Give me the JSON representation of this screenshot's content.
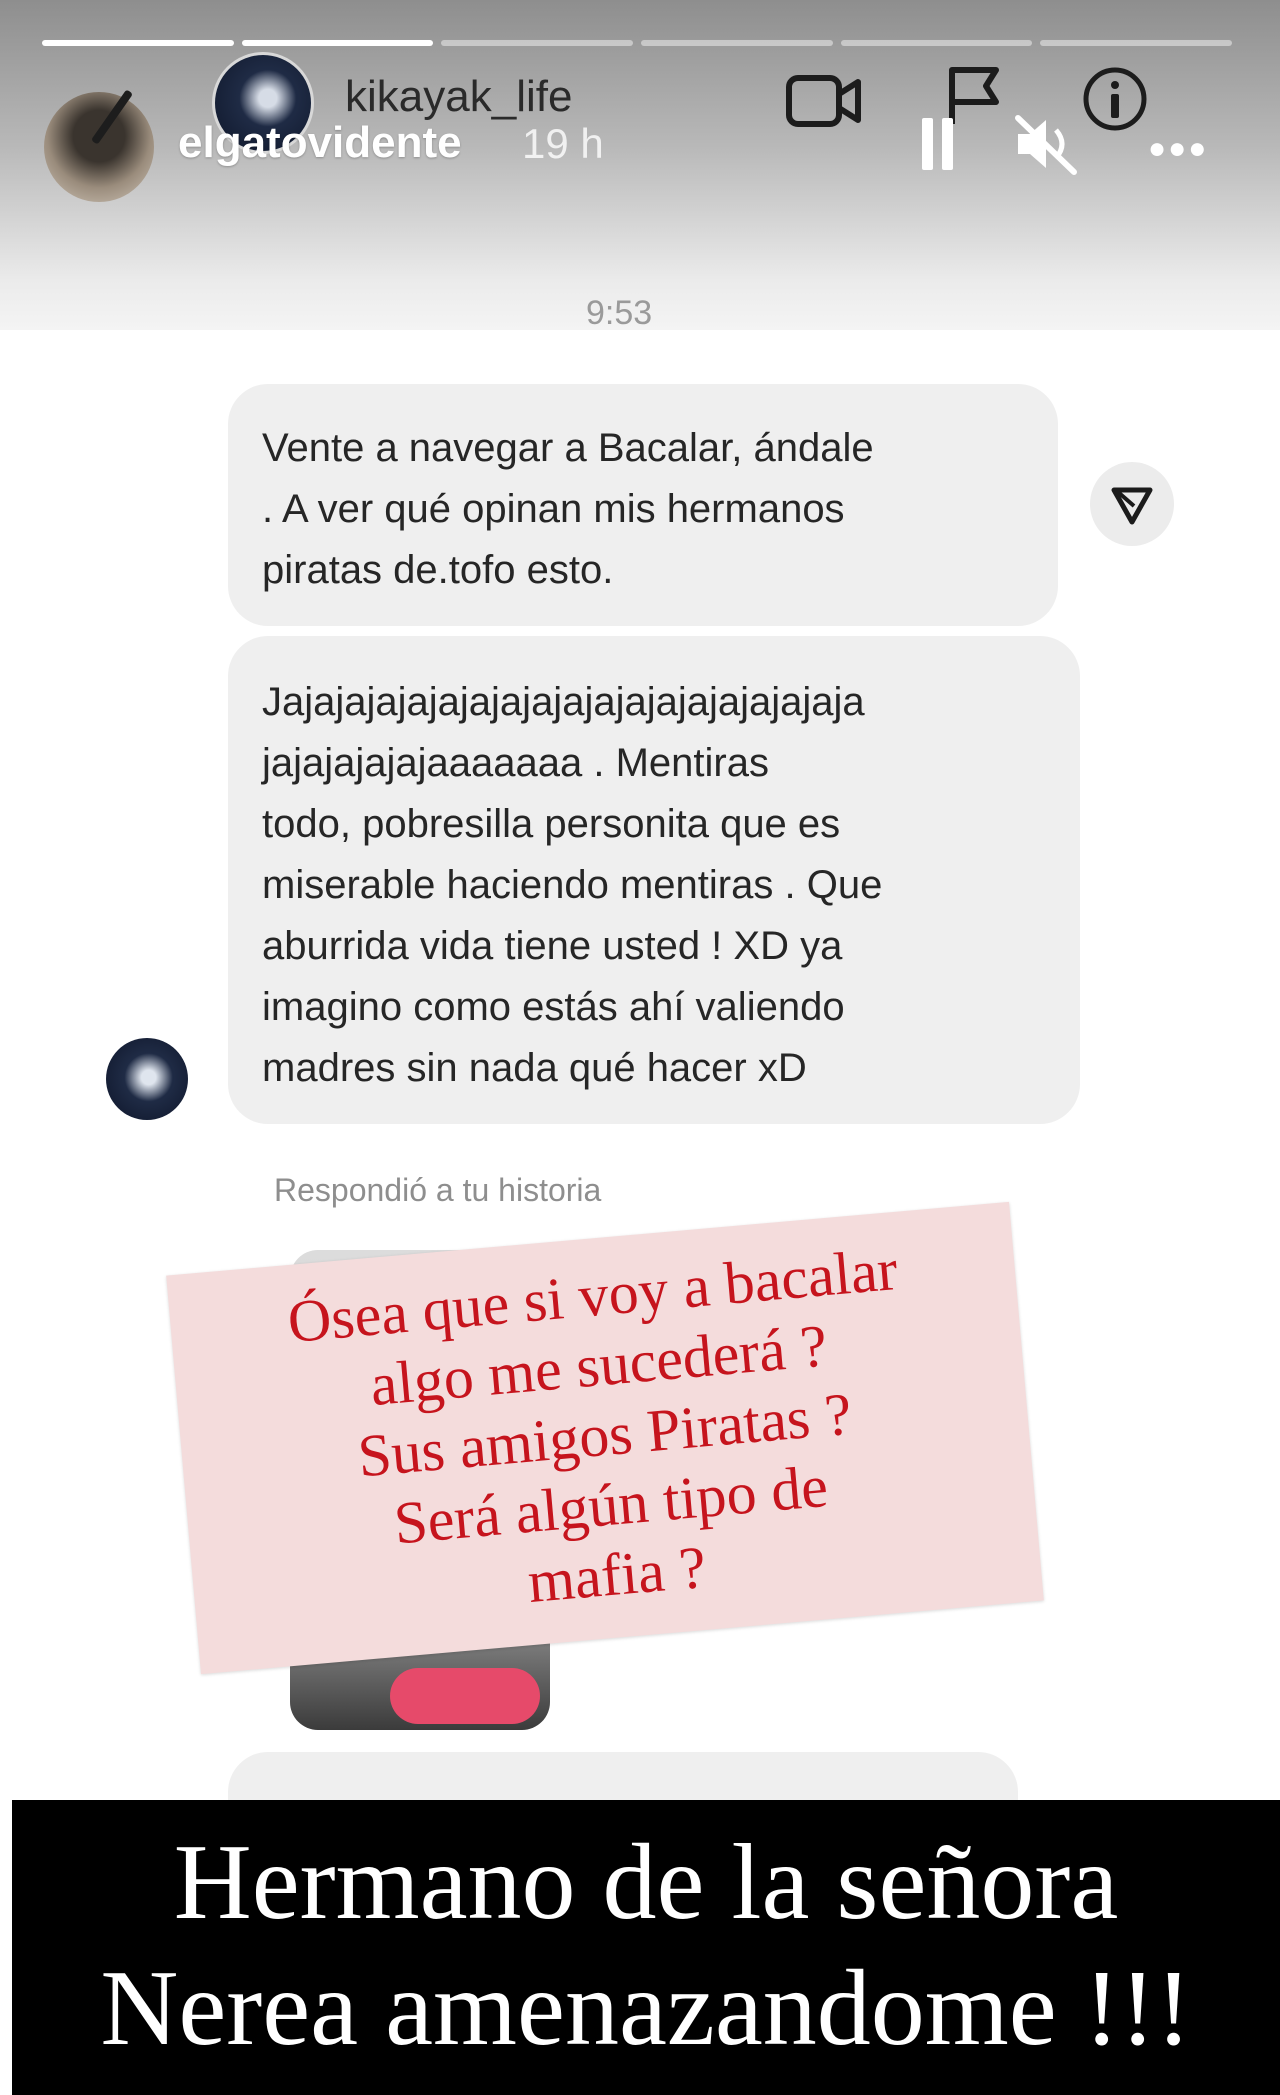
{
  "story": {
    "username": "elgatovidente",
    "time_ago": "19 h",
    "progress_segments": 6,
    "progress_done": 2
  },
  "dm": {
    "username": "kikayak_life",
    "timestamp": "9:53",
    "messages": [
      {
        "lines": [
          "Vente a navegar a Bacalar, ándale",
          ". A ver qué opinan mis hermanos",
          "piratas de.tofo esto."
        ]
      },
      {
        "lines": [
          "Jajajajajajajajajajajajajajajajajajaja",
          "jajajajajajaaaaaaa .    Mentiras",
          "todo, pobresilla personita que es",
          "miserable haciendo mentiras . Que",
          "aburrida vida tiene usted ! XD ya",
          "imagino como estás ahí valiendo",
          "madres sin nada qué hacer xD"
        ]
      }
    ],
    "replied_label": "Respondió a tu historia"
  },
  "sticker": {
    "lines": [
      "Ósea que si voy a bacalar",
      "algo me sucederá ?",
      "Sus amigos Piratas ?",
      "Será algún tipo de",
      "mafia ?"
    ],
    "color": "#c6141d",
    "background": "#f4dcdc"
  },
  "caption": {
    "lines": [
      "Hermano de la señora",
      "Nerea amenazandome !!!"
    ]
  },
  "icons": [
    "video-icon",
    "flag-icon",
    "info-icon",
    "pause-icon",
    "mute-icon",
    "more-icon",
    "share-icon"
  ]
}
